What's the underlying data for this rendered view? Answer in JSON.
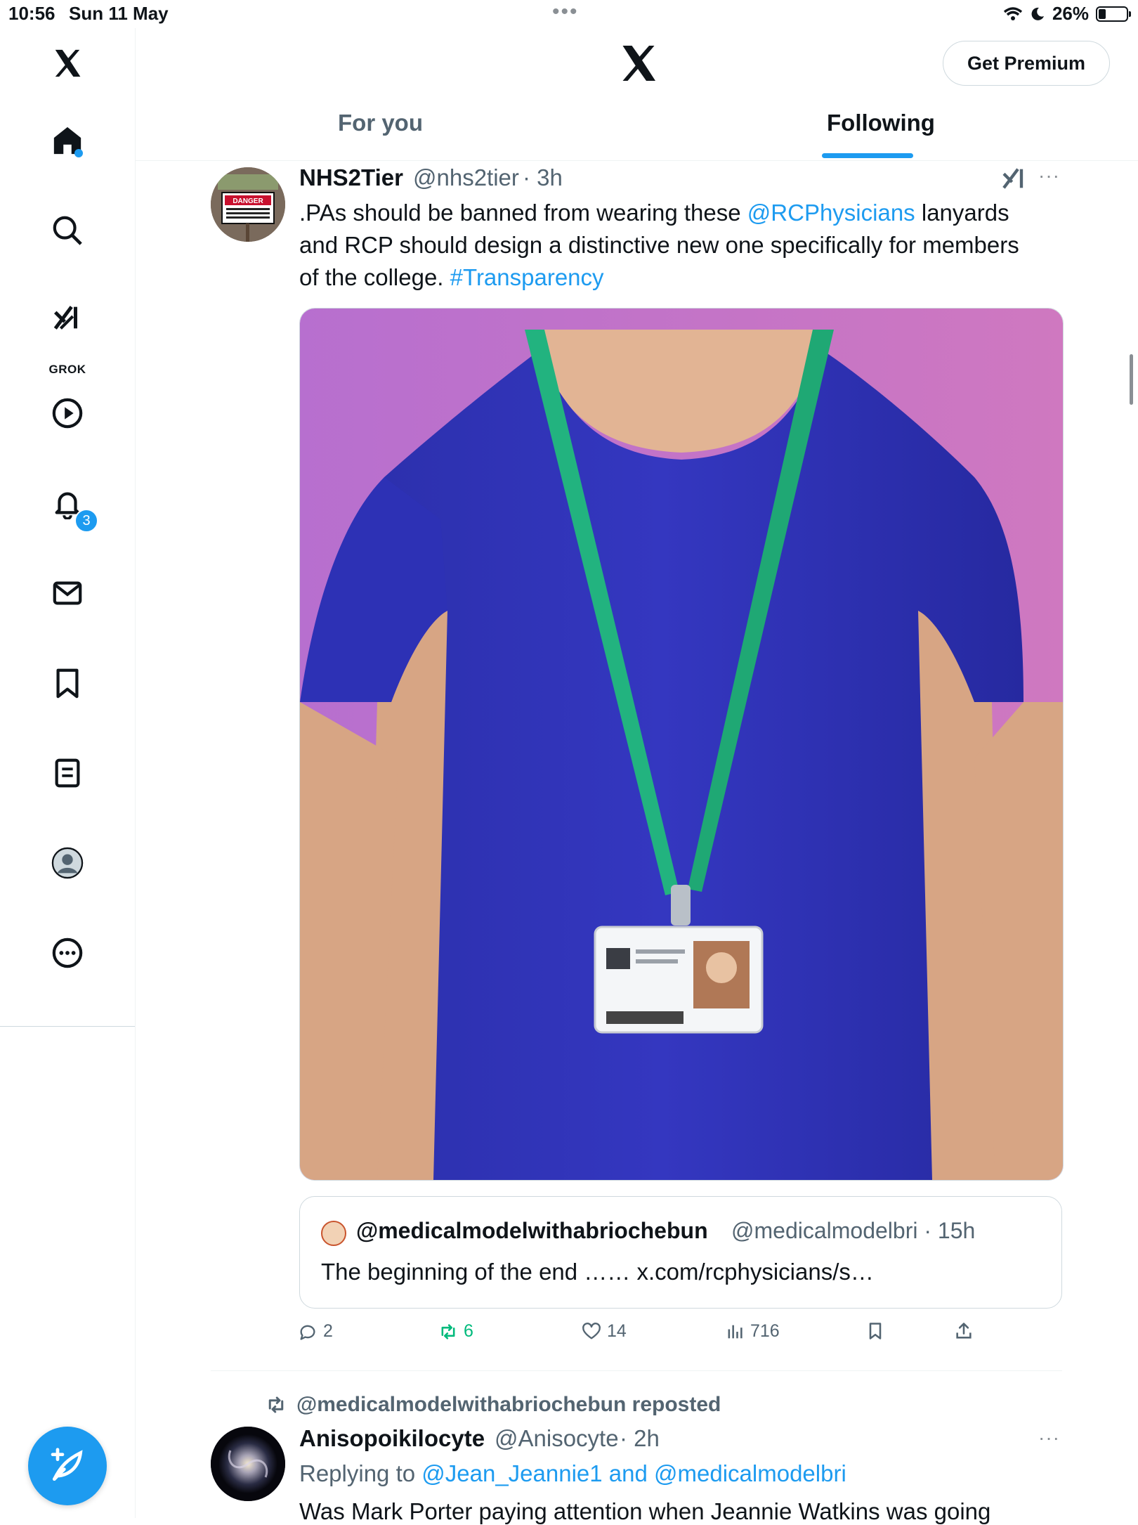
{
  "status_bar": {
    "time": "10:56",
    "date": "Sun 11 May",
    "battery": "26%"
  },
  "sidebar": {
    "items": [
      "home",
      "explore",
      "grok",
      "video",
      "notifications",
      "messages",
      "bookmarks",
      "lists",
      "profile",
      "more"
    ],
    "grok_label": "GROK",
    "notification_count": "3"
  },
  "header": {
    "premium_label": "Get Premium",
    "tabs": [
      {
        "label": "For you"
      },
      {
        "label": "Following"
      }
    ]
  },
  "tweet1": {
    "name": "NHS2Tier",
    "handle": "@nhs2tier",
    "time": "· 3h",
    "text_a": ".PAs should be banned from wearing these ",
    "mention": "@RCPhysicians",
    "text_b": " lanyards",
    "text_c": "and RCP should design a distinctive new one specifically for members",
    "text_d": "of the college. ",
    "hashtag": "#Transparency",
    "avatar_sign": "DANGER",
    "quote": {
      "name": "@medicalmodelwithabriochebun",
      "handle": "@medicalmodelbri · 15h",
      "text": "The beginning of the end …… x.com/rcphysicians/s…"
    },
    "actions": {
      "replies": "2",
      "reposts": "6",
      "likes": "14",
      "views": "716"
    }
  },
  "tweet2": {
    "repost_by": "@medicalmodelwithabriochebun reposted",
    "name": "Anisopoikilocyte",
    "handle": "@Anisocyte",
    "time": "· 2h",
    "replying_prefix": "Replying to ",
    "replying_to": "@Jean_Jeannie1 and @medicalmodelbri",
    "text_partial": "Was Mark Porter paying attention when Jeannie Watkins was going"
  },
  "colors": {
    "accent": "#1d9bf0",
    "repost_green": "#00ba7c",
    "muted": "#536471"
  }
}
